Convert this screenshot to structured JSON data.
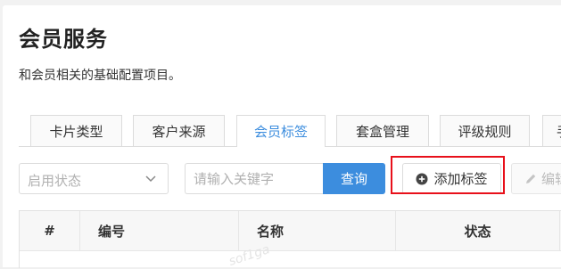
{
  "page": {
    "title": "会员服务",
    "description": "和会员相关的基础配置项目。"
  },
  "tabs": [
    {
      "label": "卡片类型",
      "active": false
    },
    {
      "label": "客户来源",
      "active": false
    },
    {
      "label": "会员标签",
      "active": true
    },
    {
      "label": "套盒管理",
      "active": false
    },
    {
      "label": "评级规则",
      "active": false
    },
    {
      "label": "手",
      "active": false
    }
  ],
  "toolbar": {
    "status_select_placeholder": "启用状态",
    "keyword_placeholder": "请输入关键字",
    "query_label": "查询",
    "add_tag_label": "添加标签",
    "edit_label": "编辑"
  },
  "table": {
    "columns": [
      "#",
      "编号",
      "名称",
      "状态"
    ]
  },
  "watermark": "sof1ga",
  "colors": {
    "accent": "#3c8dde",
    "highlight_border": "#e8101a"
  },
  "icons": {
    "select_chevron": "chevron-down-icon",
    "add": "plus-circle-icon",
    "edit": "pencil-icon"
  }
}
